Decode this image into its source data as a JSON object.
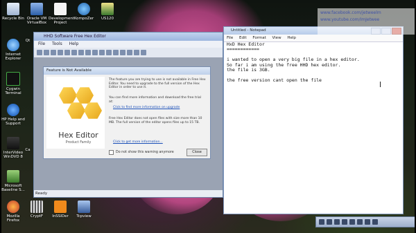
{
  "overlay": {
    "line1": "www.facebook.com/jetweelm",
    "line2": "www.youtube.com/ImJetwee"
  },
  "desktop_icons": [
    {
      "label": "Recycle Bin"
    },
    {
      "label": "Oracle VM VirtualBox"
    },
    {
      "label": "Development Project"
    },
    {
      "label": "KompoZer"
    },
    {
      "label": "US120"
    },
    {
      "label": "Internet Explorer"
    },
    {
      "label": "Cygwin Terminal"
    },
    {
      "label": "HP Help and Support"
    },
    {
      "label": "InterVideo WinDVD 8"
    },
    {
      "label": "Microsoft Baseline S..."
    },
    {
      "label": "Mozilla Firefox"
    },
    {
      "label": "CryptF"
    },
    {
      "label": "InSSIDer"
    },
    {
      "label": "Tcpview"
    },
    {
      "label": "Qt"
    },
    {
      "label": "Ca"
    }
  ],
  "hhd_window": {
    "title": "HHD Software Free Hex Editor",
    "menu": [
      "File",
      "Tools",
      "Help"
    ],
    "status": "Ready"
  },
  "dialog": {
    "title": "Feature is Not Available",
    "brand": "Hex Editor",
    "brand_sub": "Product Family",
    "para1": "The feature you are trying to use is not available in Free Hex Editor. You need to upgrade to the full version of the Hex Editor in order to use it.",
    "para2": "You can find more information and download the free trial at:",
    "link1": "Click to find more information on upgrade",
    "para3": "Free Hex Editor does not open files with size more than 10 MB. The full version of the editor opens files up to 15 TB.",
    "link2": "Click to get more information...",
    "checkbox": "Do not show this warning anymore",
    "close": "Close"
  },
  "notepad": {
    "title": "Untitled - Notepad",
    "menu": [
      "File",
      "Edit",
      "Format",
      "View",
      "Help"
    ],
    "text": "HxD Hex Editor\n============\n\ni wanted to open a very big file in a hex editor.\nSo far i am using the free HHD hex editor.\nthe file is 3GB.\n\nthe free version cant open the file"
  }
}
